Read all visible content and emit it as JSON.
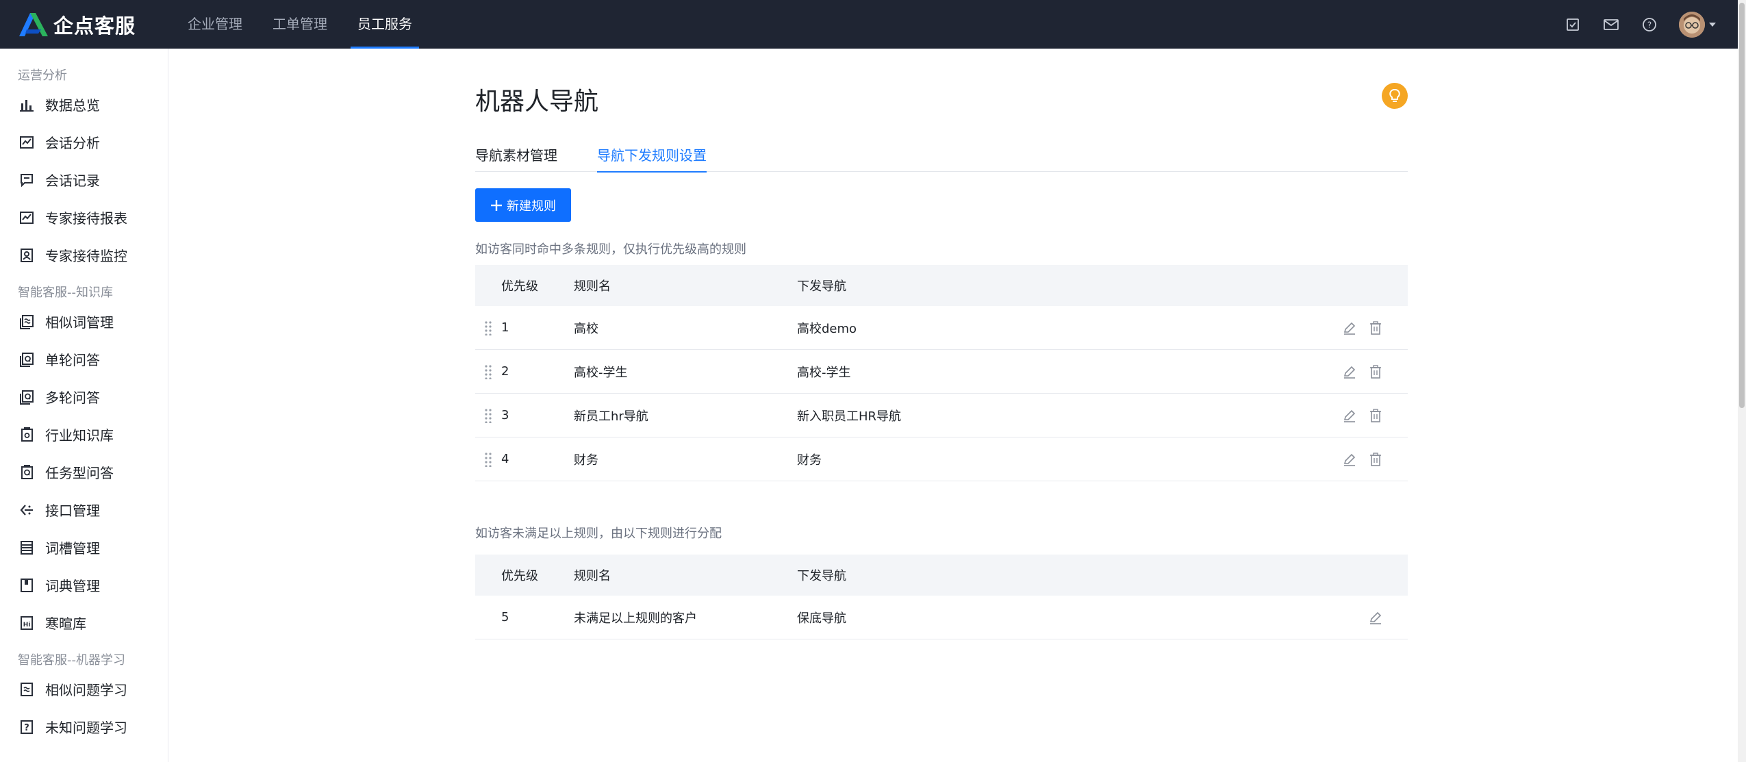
{
  "app": {
    "logo_text": "企点客服",
    "brand_colors": {
      "blue": "#1f7cff",
      "green": "#2bb35d",
      "dark": "#1f2533"
    }
  },
  "topnav": [
    {
      "label": "企业管理",
      "active": false
    },
    {
      "label": "工单管理",
      "active": false
    },
    {
      "label": "员工服务",
      "active": true
    }
  ],
  "topright": {
    "icons": [
      "task-check-icon",
      "mail-icon",
      "help-icon"
    ],
    "avatar": "avatar"
  },
  "sidebar": {
    "groups": [
      {
        "title": "运营分析",
        "items": [
          {
            "label": "数据总览",
            "icon": "bar-chart-icon"
          },
          {
            "label": "会话分析",
            "icon": "line-chart-icon"
          },
          {
            "label": "会话记录",
            "icon": "chat-record-icon"
          },
          {
            "label": "专家接待报表",
            "icon": "report-icon"
          },
          {
            "label": "专家接待监控",
            "icon": "monitor-icon"
          }
        ]
      },
      {
        "title": "智能客服--知识库",
        "items": [
          {
            "label": "相似词管理",
            "icon": "similar-word-icon"
          },
          {
            "label": "单轮问答",
            "icon": "single-qa-icon"
          },
          {
            "label": "多轮问答",
            "icon": "multi-qa-icon"
          },
          {
            "label": "行业知识库",
            "icon": "industry-kb-icon"
          },
          {
            "label": "任务型问答",
            "icon": "task-qa-icon"
          },
          {
            "label": "接口管理",
            "icon": "api-icon"
          },
          {
            "label": "词槽管理",
            "icon": "slot-icon"
          },
          {
            "label": "词典管理",
            "icon": "dictionary-icon"
          },
          {
            "label": "寒暄库",
            "icon": "greeting-icon"
          }
        ]
      },
      {
        "title": "智能客服--机器学习",
        "items": [
          {
            "label": "相似问题学习",
            "icon": "similar-question-icon"
          },
          {
            "label": "未知问题学习",
            "icon": "unknown-question-icon"
          }
        ]
      }
    ]
  },
  "main": {
    "title": "机器人导航",
    "tabs": [
      {
        "label": "导航素材管理",
        "active": false
      },
      {
        "label": "导航下发规则设置",
        "active": true
      }
    ],
    "new_button": "新建规则",
    "hint1": "如访客同时命中多条规则，仅执行优先级高的规则",
    "hint2": "如访客未满足以上规则，由以下规则进行分配",
    "columns": {
      "priority": "优先级",
      "name": "规则名",
      "nav": "下发导航"
    },
    "rules": [
      {
        "priority": "1",
        "name": "高校",
        "nav": "高校demo"
      },
      {
        "priority": "2",
        "name": "高校-学生",
        "nav": "高校-学生"
      },
      {
        "priority": "3",
        "name": "新员工hr导航",
        "nav": "新入职员工HR导航"
      },
      {
        "priority": "4",
        "name": "财务",
        "nav": "财务"
      }
    ],
    "default_rule": {
      "priority": "5",
      "name": "未满足以上规则的客户",
      "nav": "保底导航"
    }
  }
}
